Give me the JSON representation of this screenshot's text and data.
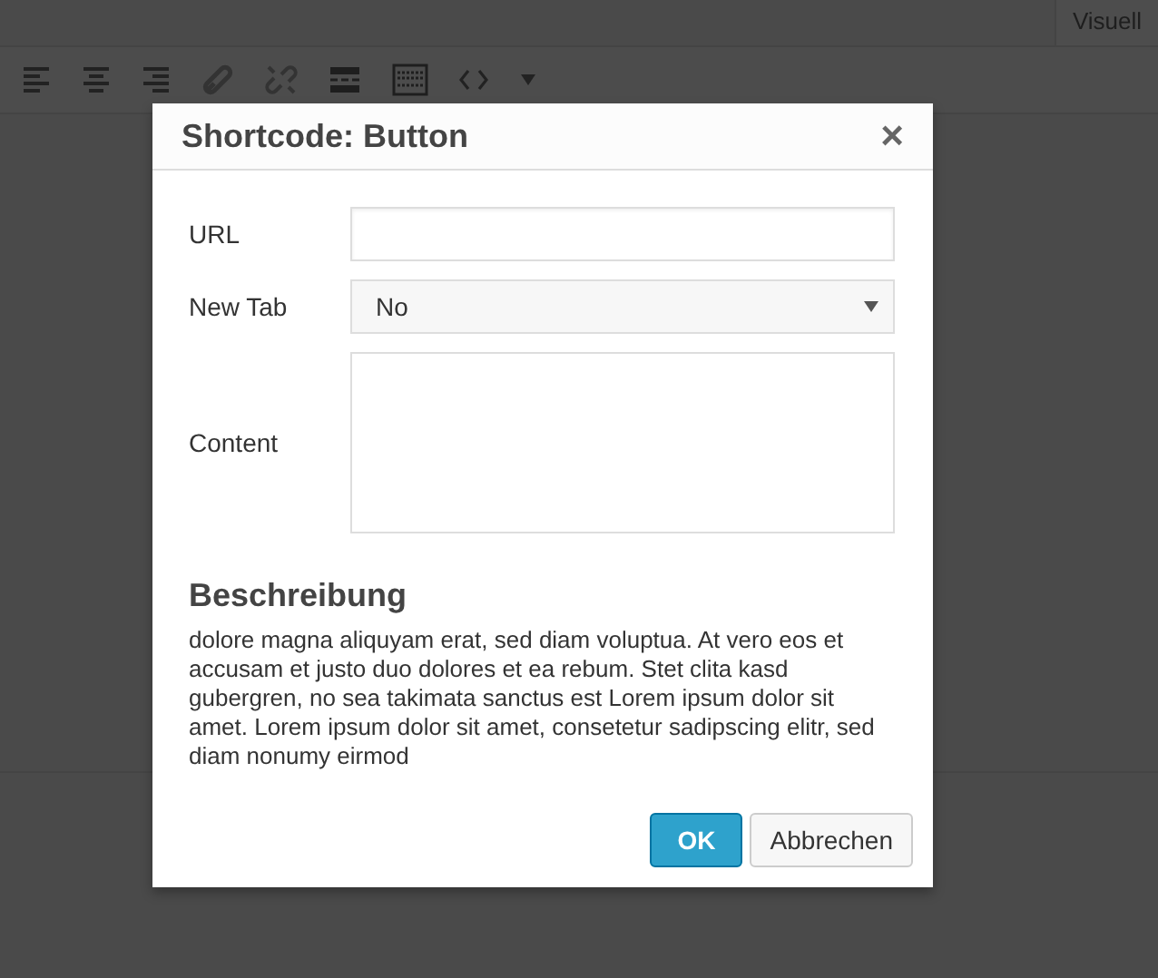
{
  "editor": {
    "tabs": [
      {
        "label": "Visuell",
        "selected": true
      }
    ]
  },
  "dialog": {
    "title": "Shortcode: Button",
    "close": "×",
    "fields": [
      {
        "kind": "text",
        "label": "URL"
      },
      {
        "kind": "select",
        "label": "New Tab",
        "value": "No"
      },
      {
        "kind": "textarea",
        "label": "Content"
      }
    ],
    "description": {
      "heading": "Beschreibung",
      "text": "dolore magna aliquyam erat, sed diam voluptua. At vero eos et accusam et justo duo dolores et ea rebum. Stet clita kasd gubergren, no sea takimata sanctus est Lorem ipsum dolor sit amet. Lorem ipsum dolor sit amet, consetetur sadipscing elitr, sed diam nonumy eirmod"
    },
    "buttons": [
      {
        "kind": "primary",
        "label": "OK"
      },
      {
        "kind": "secondary",
        "label": "Abbrechen"
      }
    ]
  }
}
